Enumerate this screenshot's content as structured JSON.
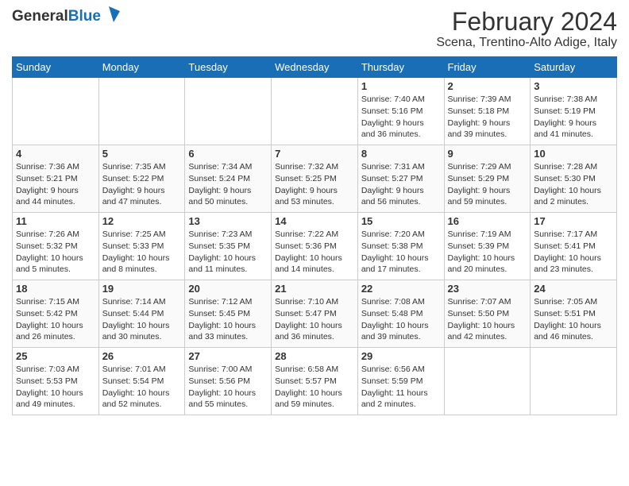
{
  "logo": {
    "general": "General",
    "blue": "Blue"
  },
  "header": {
    "title": "February 2024",
    "subtitle": "Scena, Trentino-Alto Adige, Italy"
  },
  "calendar": {
    "headers": [
      "Sunday",
      "Monday",
      "Tuesday",
      "Wednesday",
      "Thursday",
      "Friday",
      "Saturday"
    ],
    "weeks": [
      [
        {
          "day": "",
          "info": ""
        },
        {
          "day": "",
          "info": ""
        },
        {
          "day": "",
          "info": ""
        },
        {
          "day": "",
          "info": ""
        },
        {
          "day": "1",
          "info": "Sunrise: 7:40 AM\nSunset: 5:16 PM\nDaylight: 9 hours\nand 36 minutes."
        },
        {
          "day": "2",
          "info": "Sunrise: 7:39 AM\nSunset: 5:18 PM\nDaylight: 9 hours\nand 39 minutes."
        },
        {
          "day": "3",
          "info": "Sunrise: 7:38 AM\nSunset: 5:19 PM\nDaylight: 9 hours\nand 41 minutes."
        }
      ],
      [
        {
          "day": "4",
          "info": "Sunrise: 7:36 AM\nSunset: 5:21 PM\nDaylight: 9 hours\nand 44 minutes."
        },
        {
          "day": "5",
          "info": "Sunrise: 7:35 AM\nSunset: 5:22 PM\nDaylight: 9 hours\nand 47 minutes."
        },
        {
          "day": "6",
          "info": "Sunrise: 7:34 AM\nSunset: 5:24 PM\nDaylight: 9 hours\nand 50 minutes."
        },
        {
          "day": "7",
          "info": "Sunrise: 7:32 AM\nSunset: 5:25 PM\nDaylight: 9 hours\nand 53 minutes."
        },
        {
          "day": "8",
          "info": "Sunrise: 7:31 AM\nSunset: 5:27 PM\nDaylight: 9 hours\nand 56 minutes."
        },
        {
          "day": "9",
          "info": "Sunrise: 7:29 AM\nSunset: 5:29 PM\nDaylight: 9 hours\nand 59 minutes."
        },
        {
          "day": "10",
          "info": "Sunrise: 7:28 AM\nSunset: 5:30 PM\nDaylight: 10 hours\nand 2 minutes."
        }
      ],
      [
        {
          "day": "11",
          "info": "Sunrise: 7:26 AM\nSunset: 5:32 PM\nDaylight: 10 hours\nand 5 minutes."
        },
        {
          "day": "12",
          "info": "Sunrise: 7:25 AM\nSunset: 5:33 PM\nDaylight: 10 hours\nand 8 minutes."
        },
        {
          "day": "13",
          "info": "Sunrise: 7:23 AM\nSunset: 5:35 PM\nDaylight: 10 hours\nand 11 minutes."
        },
        {
          "day": "14",
          "info": "Sunrise: 7:22 AM\nSunset: 5:36 PM\nDaylight: 10 hours\nand 14 minutes."
        },
        {
          "day": "15",
          "info": "Sunrise: 7:20 AM\nSunset: 5:38 PM\nDaylight: 10 hours\nand 17 minutes."
        },
        {
          "day": "16",
          "info": "Sunrise: 7:19 AM\nSunset: 5:39 PM\nDaylight: 10 hours\nand 20 minutes."
        },
        {
          "day": "17",
          "info": "Sunrise: 7:17 AM\nSunset: 5:41 PM\nDaylight: 10 hours\nand 23 minutes."
        }
      ],
      [
        {
          "day": "18",
          "info": "Sunrise: 7:15 AM\nSunset: 5:42 PM\nDaylight: 10 hours\nand 26 minutes."
        },
        {
          "day": "19",
          "info": "Sunrise: 7:14 AM\nSunset: 5:44 PM\nDaylight: 10 hours\nand 30 minutes."
        },
        {
          "day": "20",
          "info": "Sunrise: 7:12 AM\nSunset: 5:45 PM\nDaylight: 10 hours\nand 33 minutes."
        },
        {
          "day": "21",
          "info": "Sunrise: 7:10 AM\nSunset: 5:47 PM\nDaylight: 10 hours\nand 36 minutes."
        },
        {
          "day": "22",
          "info": "Sunrise: 7:08 AM\nSunset: 5:48 PM\nDaylight: 10 hours\nand 39 minutes."
        },
        {
          "day": "23",
          "info": "Sunrise: 7:07 AM\nSunset: 5:50 PM\nDaylight: 10 hours\nand 42 minutes."
        },
        {
          "day": "24",
          "info": "Sunrise: 7:05 AM\nSunset: 5:51 PM\nDaylight: 10 hours\nand 46 minutes."
        }
      ],
      [
        {
          "day": "25",
          "info": "Sunrise: 7:03 AM\nSunset: 5:53 PM\nDaylight: 10 hours\nand 49 minutes."
        },
        {
          "day": "26",
          "info": "Sunrise: 7:01 AM\nSunset: 5:54 PM\nDaylight: 10 hours\nand 52 minutes."
        },
        {
          "day": "27",
          "info": "Sunrise: 7:00 AM\nSunset: 5:56 PM\nDaylight: 10 hours\nand 55 minutes."
        },
        {
          "day": "28",
          "info": "Sunrise: 6:58 AM\nSunset: 5:57 PM\nDaylight: 10 hours\nand 59 minutes."
        },
        {
          "day": "29",
          "info": "Sunrise: 6:56 AM\nSunset: 5:59 PM\nDaylight: 11 hours\nand 2 minutes."
        },
        {
          "day": "",
          "info": ""
        },
        {
          "day": "",
          "info": ""
        }
      ]
    ]
  }
}
